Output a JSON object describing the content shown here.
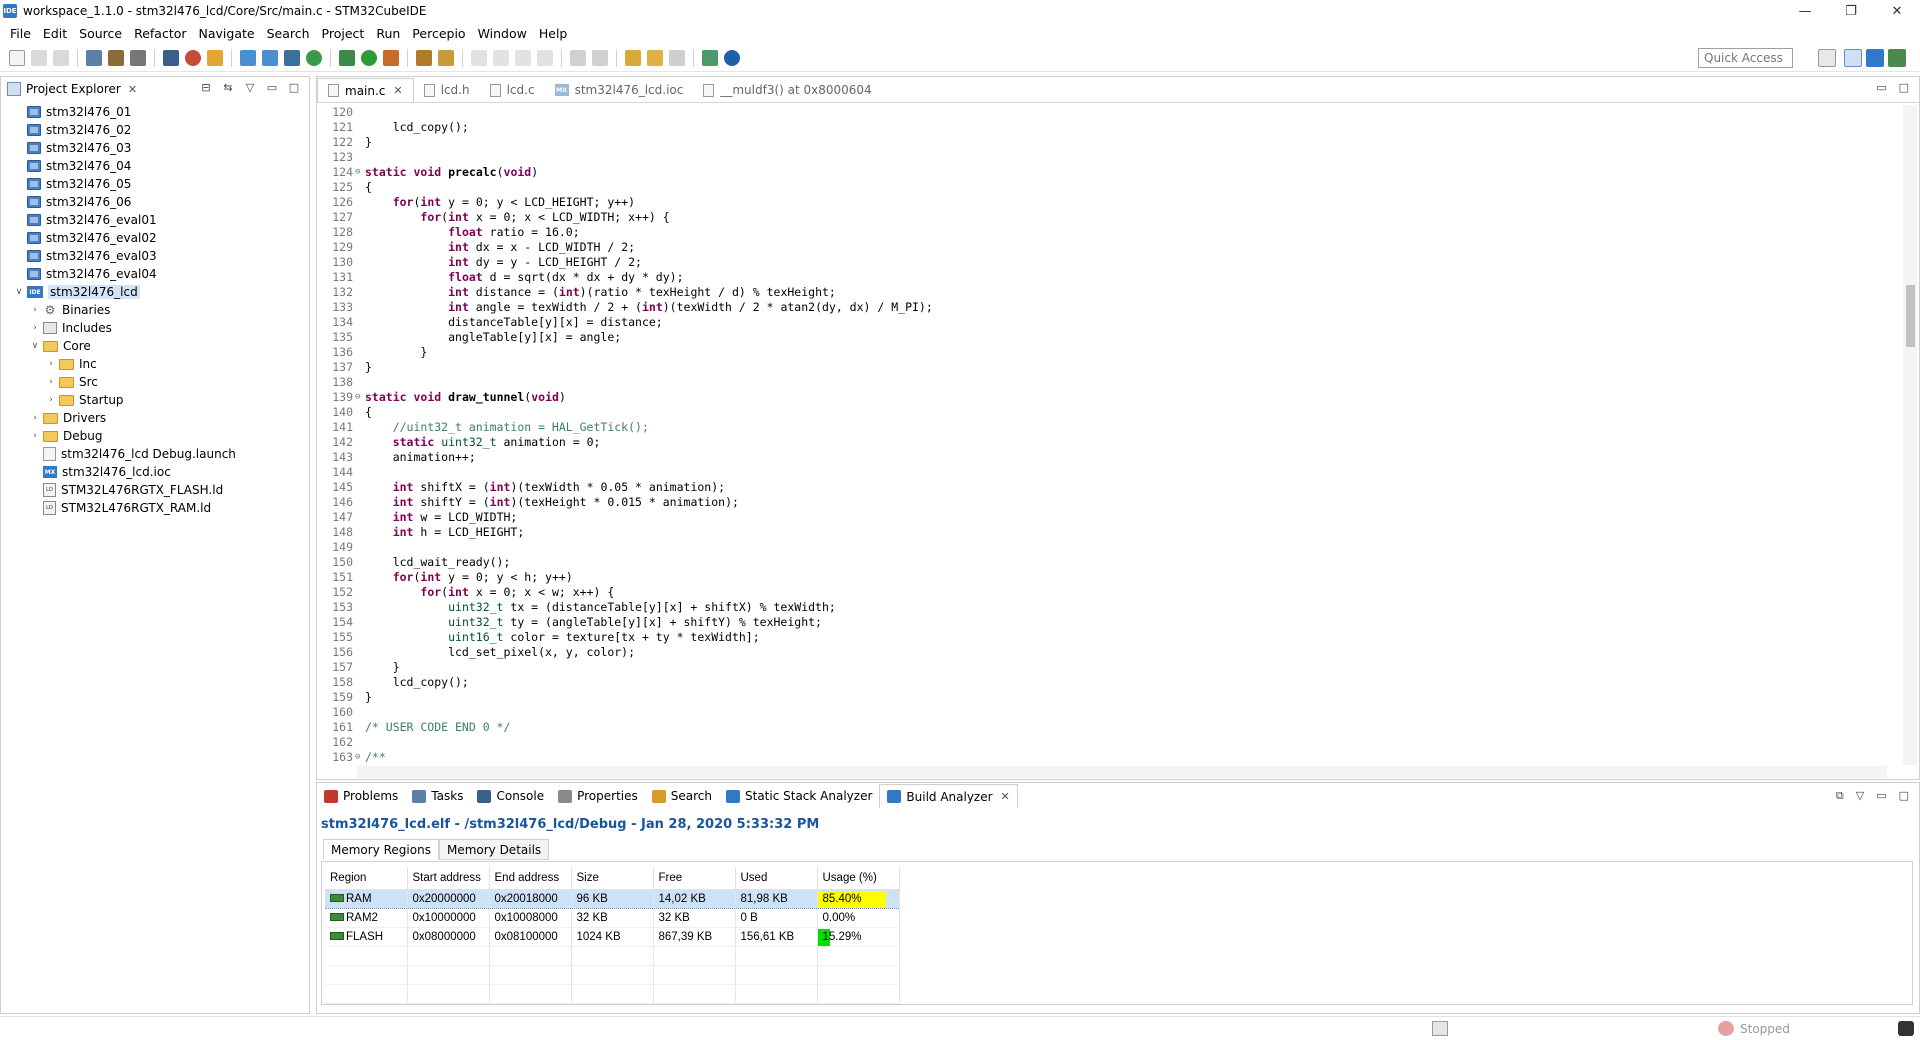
{
  "window": {
    "title": "workspace_1.1.0 - stm32l476_lcd/Core/Src/main.c - STM32CubeIDE",
    "app_icon": "IDE",
    "controls": [
      "—",
      "❐",
      "✕"
    ]
  },
  "menu": [
    "File",
    "Edit",
    "Source",
    "Refactor",
    "Navigate",
    "Search",
    "Project",
    "Run",
    "Percepio",
    "Window",
    "Help"
  ],
  "toolbar": {
    "quick_access_placeholder": "Quick Access"
  },
  "project_explorer": {
    "title": "Project Explorer",
    "items": [
      {
        "label": "stm32l476_01",
        "level": 0,
        "icon": "project",
        "twisty": ""
      },
      {
        "label": "stm32l476_02",
        "level": 0,
        "icon": "project",
        "twisty": ""
      },
      {
        "label": "stm32l476_03",
        "level": 0,
        "icon": "project",
        "twisty": ""
      },
      {
        "label": "stm32l476_04",
        "level": 0,
        "icon": "project",
        "twisty": ""
      },
      {
        "label": "stm32l476_05",
        "level": 0,
        "icon": "project",
        "twisty": ""
      },
      {
        "label": "stm32l476_06",
        "level": 0,
        "icon": "project",
        "twisty": ""
      },
      {
        "label": "stm32l476_eval01",
        "level": 0,
        "icon": "project",
        "twisty": ""
      },
      {
        "label": "stm32l476_eval02",
        "level": 0,
        "icon": "project",
        "twisty": ""
      },
      {
        "label": "stm32l476_eval03",
        "level": 0,
        "icon": "project",
        "twisty": ""
      },
      {
        "label": "stm32l476_eval04",
        "level": 0,
        "icon": "project",
        "twisty": ""
      },
      {
        "label": "stm32l476_lcd",
        "level": 0,
        "icon": "ide-project",
        "twisty": "open",
        "selected": true
      },
      {
        "label": "Binaries",
        "level": 1,
        "icon": "binaries",
        "twisty": "closed"
      },
      {
        "label": "Includes",
        "level": 1,
        "icon": "includes",
        "twisty": "closed"
      },
      {
        "label": "Core",
        "level": 1,
        "icon": "folder",
        "twisty": "open"
      },
      {
        "label": "Inc",
        "level": 2,
        "icon": "folder",
        "twisty": "closed"
      },
      {
        "label": "Src",
        "level": 2,
        "icon": "folder",
        "twisty": "closed"
      },
      {
        "label": "Startup",
        "level": 2,
        "icon": "folder",
        "twisty": "closed"
      },
      {
        "label": "Drivers",
        "level": 1,
        "icon": "folder",
        "twisty": "closed"
      },
      {
        "label": "Debug",
        "level": 1,
        "icon": "folder",
        "twisty": "closed"
      },
      {
        "label": "stm32l476_lcd Debug.launch",
        "level": 1,
        "icon": "launch",
        "twisty": ""
      },
      {
        "label": "stm32l476_lcd.ioc",
        "level": 1,
        "icon": "mx",
        "twisty": ""
      },
      {
        "label": "STM32L476RGTX_FLASH.ld",
        "level": 1,
        "icon": "ld",
        "twisty": ""
      },
      {
        "label": "STM32L476RGTX_RAM.ld",
        "level": 1,
        "icon": "ld",
        "twisty": ""
      }
    ]
  },
  "editor": {
    "tabs": [
      {
        "label": "main.c",
        "active": true,
        "icon": "c-file"
      },
      {
        "label": "lcd.h",
        "active": false,
        "icon": "h-file"
      },
      {
        "label": "lcd.c",
        "active": false,
        "icon": "c-file"
      },
      {
        "label": "stm32l476_lcd.ioc",
        "active": false,
        "icon": "mx"
      },
      {
        "label": "__muldf3() at 0x8000604",
        "active": false,
        "icon": "c-file"
      }
    ],
    "lines": [
      {
        "n": "120",
        "f": "",
        "code": ""
      },
      {
        "n": "121",
        "f": "",
        "code": "    lcd_copy();"
      },
      {
        "n": "122",
        "f": "",
        "code": "}"
      },
      {
        "n": "123",
        "f": "",
        "code": ""
      },
      {
        "n": "124",
        "f": "⊖",
        "code": "static void precalc(void)"
      },
      {
        "n": "125",
        "f": "",
        "code": "{"
      },
      {
        "n": "126",
        "f": "",
        "code": "    for(int y = 0; y < LCD_HEIGHT; y++)"
      },
      {
        "n": "127",
        "f": "",
        "code": "        for(int x = 0; x < LCD_WIDTH; x++) {"
      },
      {
        "n": "128",
        "f": "",
        "code": "            float ratio = 16.0;"
      },
      {
        "n": "129",
        "f": "",
        "code": "            int dx = x - LCD_WIDTH / 2;"
      },
      {
        "n": "130",
        "f": "",
        "code": "            int dy = y - LCD_HEIGHT / 2;"
      },
      {
        "n": "131",
        "f": "",
        "code": "            float d = sqrt(dx * dx + dy * dy);"
      },
      {
        "n": "132",
        "f": "",
        "code": "            int distance = (int)(ratio * texHeight / d) % texHeight;"
      },
      {
        "n": "133",
        "f": "",
        "code": "            int angle = texWidth / 2 + (int)(texWidth / 2 * atan2(dy, dx) / M_PI);"
      },
      {
        "n": "134",
        "f": "",
        "code": "            distanceTable[y][x] = distance;"
      },
      {
        "n": "135",
        "f": "",
        "code": "            angleTable[y][x] = angle;"
      },
      {
        "n": "136",
        "f": "",
        "code": "        }"
      },
      {
        "n": "137",
        "f": "",
        "code": "}"
      },
      {
        "n": "138",
        "f": "",
        "code": ""
      },
      {
        "n": "139",
        "f": "⊖",
        "code": "static void draw_tunnel(void)"
      },
      {
        "n": "140",
        "f": "",
        "code": "{"
      },
      {
        "n": "141",
        "f": "",
        "code": "    //uint32_t animation = HAL_GetTick();"
      },
      {
        "n": "142",
        "f": "",
        "code": "    static uint32_t animation = 0;"
      },
      {
        "n": "143",
        "f": "",
        "code": "    animation++;"
      },
      {
        "n": "144",
        "f": "",
        "code": ""
      },
      {
        "n": "145",
        "f": "",
        "code": "    int shiftX = (int)(texWidth * 0.05 * animation);"
      },
      {
        "n": "146",
        "f": "",
        "code": "    int shiftY = (int)(texHeight * 0.015 * animation);"
      },
      {
        "n": "147",
        "f": "",
        "code": "    int w = LCD_WIDTH;"
      },
      {
        "n": "148",
        "f": "",
        "code": "    int h = LCD_HEIGHT;"
      },
      {
        "n": "149",
        "f": "",
        "code": ""
      },
      {
        "n": "150",
        "f": "",
        "code": "    lcd_wait_ready();"
      },
      {
        "n": "151",
        "f": "",
        "code": "    for(int y = 0; y < h; y++)"
      },
      {
        "n": "152",
        "f": "",
        "code": "        for(int x = 0; x < w; x++) {"
      },
      {
        "n": "153",
        "f": "",
        "code": "            uint32_t tx = (distanceTable[y][x] + shiftX) % texWidth;"
      },
      {
        "n": "154",
        "f": "",
        "code": "            uint32_t ty = (angleTable[y][x] + shiftY) % texHeight;"
      },
      {
        "n": "155",
        "f": "",
        "code": "            uint16_t color = texture[tx + ty * texWidth];"
      },
      {
        "n": "156",
        "f": "",
        "code": "            lcd_set_pixel(x, y, color);"
      },
      {
        "n": "157",
        "f": "",
        "code": "    }"
      },
      {
        "n": "158",
        "f": "",
        "code": "    lcd_copy();"
      },
      {
        "n": "159",
        "f": "",
        "code": "}"
      },
      {
        "n": "160",
        "f": "",
        "code": ""
      },
      {
        "n": "161",
        "f": "",
        "code": "/* USER CODE END 0 */"
      },
      {
        "n": "162",
        "f": "",
        "code": ""
      },
      {
        "n": "163",
        "f": "⊖",
        "code": "/**"
      }
    ]
  },
  "bottom_panel": {
    "tabs": [
      {
        "label": "Problems",
        "active": false,
        "color": "#c0392b"
      },
      {
        "label": "Tasks",
        "active": false,
        "color": "#5a7fa8"
      },
      {
        "label": "Console",
        "active": false,
        "color": "#3a5f8a"
      },
      {
        "label": "Properties",
        "active": false,
        "color": "#8a8a8a"
      },
      {
        "label": "Search",
        "active": false,
        "color": "#d89a2a"
      },
      {
        "label": "Static Stack Analyzer",
        "active": false,
        "color": "#2f79c9"
      },
      {
        "label": "Build Analyzer",
        "active": true,
        "color": "#2f79c9"
      }
    ],
    "build_analyzer": {
      "header": "stm32l476_lcd.elf - /stm32l476_lcd/Debug - Jan 28, 2020 5:33:32 PM",
      "subtabs": [
        "Memory Regions",
        "Memory Details"
      ],
      "columns": [
        "Region",
        "Start address",
        "End address",
        "Size",
        "Free",
        "Used",
        "Usage (%)"
      ],
      "rows": [
        {
          "region": "RAM",
          "start": "0x20000000",
          "end": "0x20018000",
          "size": "96 KB",
          "free": "14,02 KB",
          "used": "81,98 KB",
          "usage": "85.40%",
          "usage_value": 85.4,
          "bar_color": "#ffff00",
          "selected": true
        },
        {
          "region": "RAM2",
          "start": "0x10000000",
          "end": "0x10008000",
          "size": "32 KB",
          "free": "32 KB",
          "used": "0 B",
          "usage": "0.00%",
          "usage_value": 0.0,
          "bar_color": "#ffff00",
          "selected": false
        },
        {
          "region": "FLASH",
          "start": "0x08000000",
          "end": "0x08100000",
          "size": "1024 KB",
          "free": "867,39 KB",
          "used": "156,61 KB",
          "usage": "15.29%",
          "usage_value": 15.29,
          "bar_color": "#00e000",
          "selected": false
        }
      ]
    }
  },
  "status_bar": {
    "state": "Stopped"
  }
}
